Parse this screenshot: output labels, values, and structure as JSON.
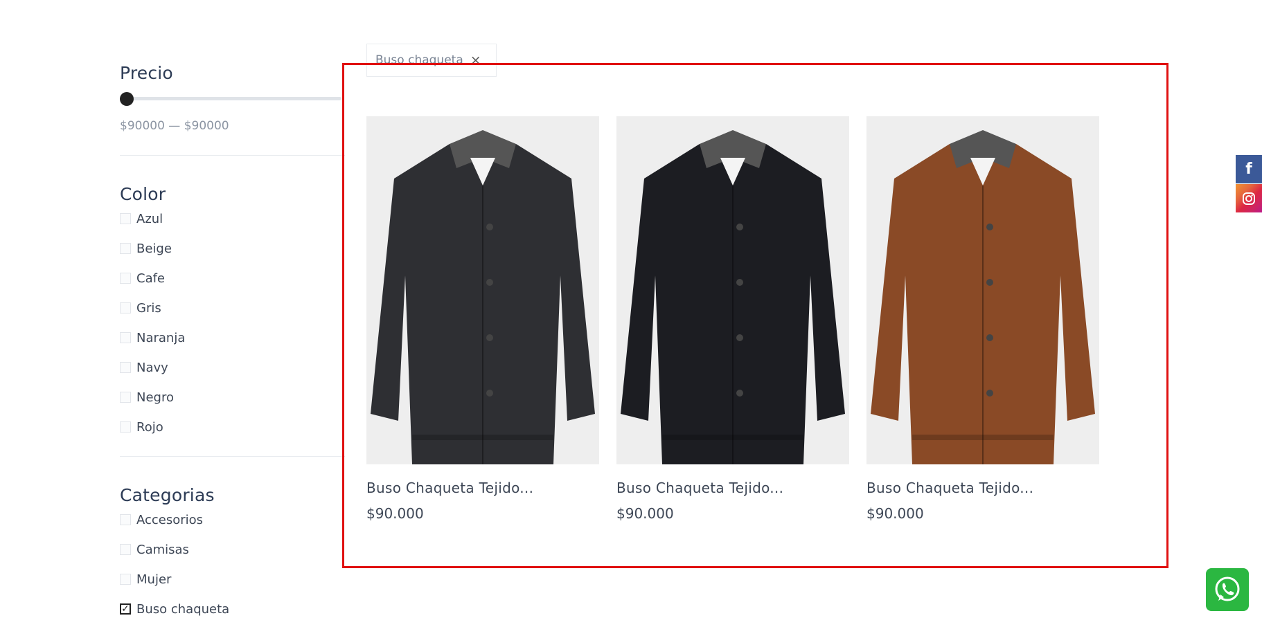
{
  "sidebar": {
    "price": {
      "title": "Precio",
      "range_text": "$90000 — $90000"
    },
    "color": {
      "title": "Color",
      "options": [
        "Azul",
        "Beige",
        "Cafe",
        "Gris",
        "Naranja",
        "Navy",
        "Negro",
        "Rojo"
      ]
    },
    "categories": {
      "title": "Categorias",
      "options": [
        "Accesorios",
        "Camisas",
        "Mujer",
        "Buso chaqueta"
      ],
      "checked": "Buso chaqueta"
    }
  },
  "active_filter": {
    "label": "Buso chaqueta",
    "remove_icon": "×"
  },
  "products": [
    {
      "title": "Buso Chaqueta Tejido...",
      "price": "$90.000",
      "jacket_color": "#2e2f33",
      "image_icon": "jacket-gray"
    },
    {
      "title": "Buso Chaqueta Tejido...",
      "price": "$90.000",
      "jacket_color": "#1c1d22",
      "image_icon": "jacket-black"
    },
    {
      "title": "Buso Chaqueta Tejido...",
      "price": "$90.000",
      "jacket_color": "#8a4a26",
      "image_icon": "jacket-brown"
    }
  ],
  "social": {
    "facebook_icon": "f",
    "instagram_icon": "instagram-icon"
  },
  "colors": {
    "highlight": "#e01010",
    "facebook": "#3b5998",
    "whatsapp": "#2bb741"
  }
}
